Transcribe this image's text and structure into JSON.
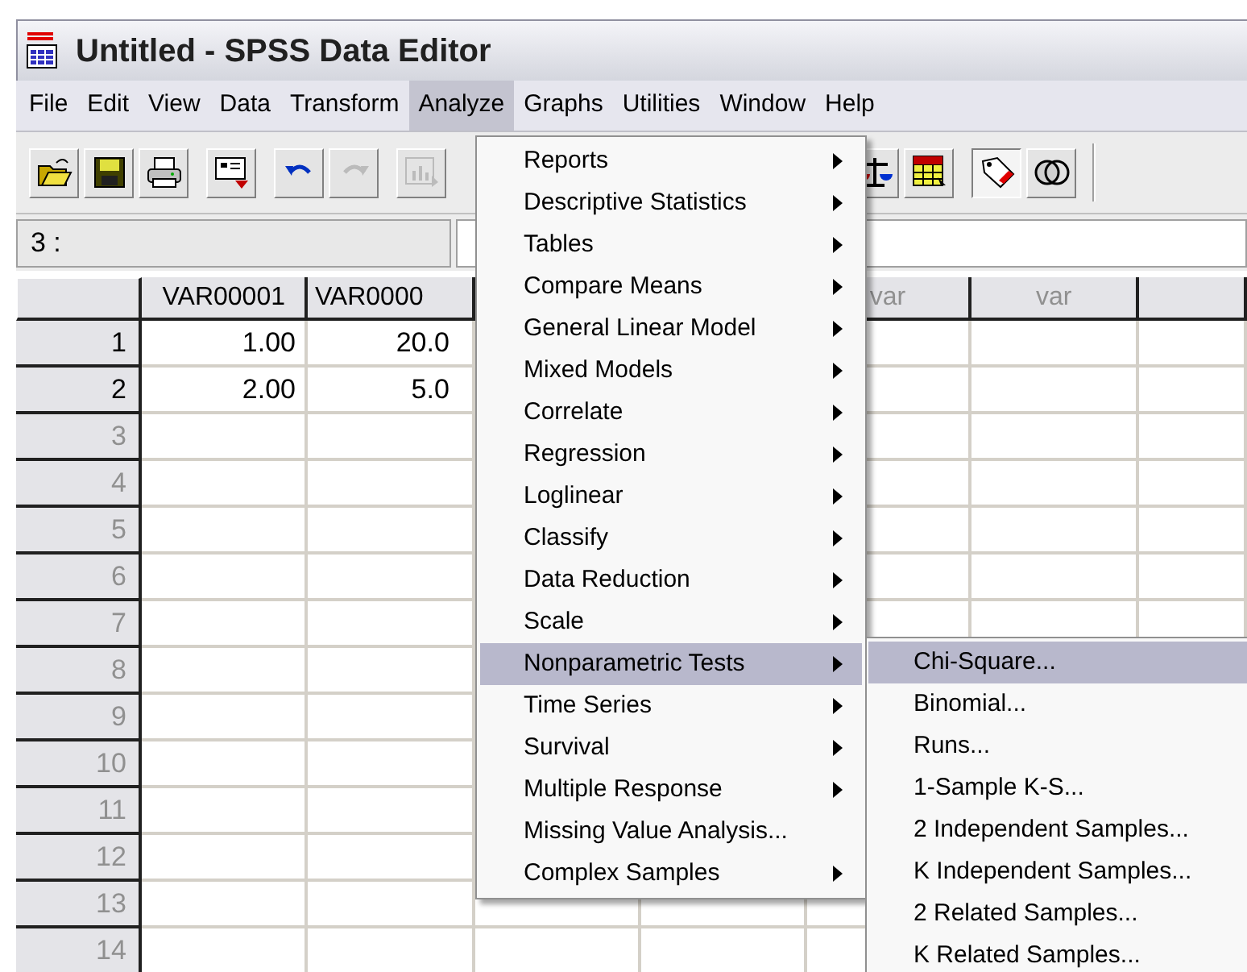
{
  "window": {
    "title": "Untitled - SPSS Data Editor"
  },
  "menu_bar": [
    {
      "label": "File",
      "selected": false
    },
    {
      "label": "Edit",
      "selected": false
    },
    {
      "label": "View",
      "selected": false
    },
    {
      "label": "Data",
      "selected": false
    },
    {
      "label": "Transform",
      "selected": false
    },
    {
      "label": "Analyze",
      "selected": true
    },
    {
      "label": "Graphs",
      "selected": false
    },
    {
      "label": "Utilities",
      "selected": false
    },
    {
      "label": "Window",
      "selected": false
    },
    {
      "label": "Help",
      "selected": false
    }
  ],
  "toolbar": {
    "left": [
      {
        "kind": "open",
        "disabled": false,
        "pressed": false
      },
      {
        "kind": "save",
        "disabled": false,
        "pressed": false
      },
      {
        "kind": "print",
        "disabled": false,
        "pressed": false
      },
      {
        "kind": "dialog",
        "disabled": false,
        "pressed": false
      },
      {
        "kind": "undo",
        "disabled": false,
        "pressed": false
      },
      {
        "kind": "redo",
        "disabled": true,
        "pressed": false
      },
      {
        "kind": "chart",
        "disabled": true,
        "pressed": false
      }
    ],
    "right": [
      {
        "kind": "scale",
        "disabled": false,
        "pressed": false
      },
      {
        "kind": "table",
        "disabled": false,
        "pressed": false
      },
      {
        "kind": "tag",
        "disabled": false,
        "pressed": true
      },
      {
        "kind": "circles",
        "disabled": false,
        "pressed": false
      }
    ]
  },
  "cell_editor": {
    "cell": "3 :"
  },
  "grid": {
    "columns": [
      {
        "label": "VAR00001"
      },
      {
        "label": "VAR0000"
      },
      {
        "label": "var"
      },
      {
        "label": "var"
      }
    ],
    "rows": [
      {
        "number": "1",
        "cells": [
          "1.00",
          "20.0"
        ]
      },
      {
        "number": "2",
        "cells": [
          "2.00",
          "5.0"
        ]
      },
      {
        "number": "3",
        "cells": []
      },
      {
        "number": "4",
        "cells": []
      },
      {
        "number": "5",
        "cells": []
      },
      {
        "number": "6",
        "cells": []
      },
      {
        "number": "7",
        "cells": []
      },
      {
        "number": "8",
        "cells": []
      },
      {
        "number": "9",
        "cells": []
      },
      {
        "number": "10",
        "cells": []
      },
      {
        "number": "11",
        "cells": []
      },
      {
        "number": "12",
        "cells": []
      },
      {
        "number": "13",
        "cells": []
      },
      {
        "number": "14",
        "cells": []
      }
    ]
  },
  "analyze_menu": {
    "items": [
      {
        "label": "Reports",
        "submenu": true,
        "selected": false
      },
      {
        "label": "Descriptive Statistics",
        "submenu": true,
        "selected": false
      },
      {
        "label": "Tables",
        "submenu": true,
        "selected": false
      },
      {
        "label": "Compare Means",
        "submenu": true,
        "selected": false
      },
      {
        "label": "General Linear Model",
        "submenu": true,
        "selected": false
      },
      {
        "label": "Mixed Models",
        "submenu": true,
        "selected": false
      },
      {
        "label": "Correlate",
        "submenu": true,
        "selected": false
      },
      {
        "label": "Regression",
        "submenu": true,
        "selected": false
      },
      {
        "label": "Loglinear",
        "submenu": true,
        "selected": false
      },
      {
        "label": "Classify",
        "submenu": true,
        "selected": false
      },
      {
        "label": "Data Reduction",
        "submenu": true,
        "selected": false
      },
      {
        "label": "Scale",
        "submenu": true,
        "selected": false
      },
      {
        "label": "Nonparametric Tests",
        "submenu": true,
        "selected": true
      },
      {
        "label": "Time Series",
        "submenu": true,
        "selected": false
      },
      {
        "label": "Survival",
        "submenu": true,
        "selected": false
      },
      {
        "label": "Multiple Response",
        "submenu": true,
        "selected": false
      },
      {
        "label": "Missing Value Analysis...",
        "submenu": false,
        "selected": false
      },
      {
        "label": "Complex Samples",
        "submenu": true,
        "selected": false
      }
    ]
  },
  "submenu": {
    "items": [
      {
        "label": "Chi-Square...",
        "selected": true
      },
      {
        "label": "Binomial...",
        "selected": false
      },
      {
        "label": "Runs...",
        "selected": false
      },
      {
        "label": "1-Sample K-S...",
        "selected": false
      },
      {
        "label": "2 Independent Samples...",
        "selected": false
      },
      {
        "label": "K Independent Samples...",
        "selected": false
      },
      {
        "label": "2 Related Samples...",
        "selected": false
      },
      {
        "label": "K Related Samples...",
        "selected": false
      }
    ]
  }
}
